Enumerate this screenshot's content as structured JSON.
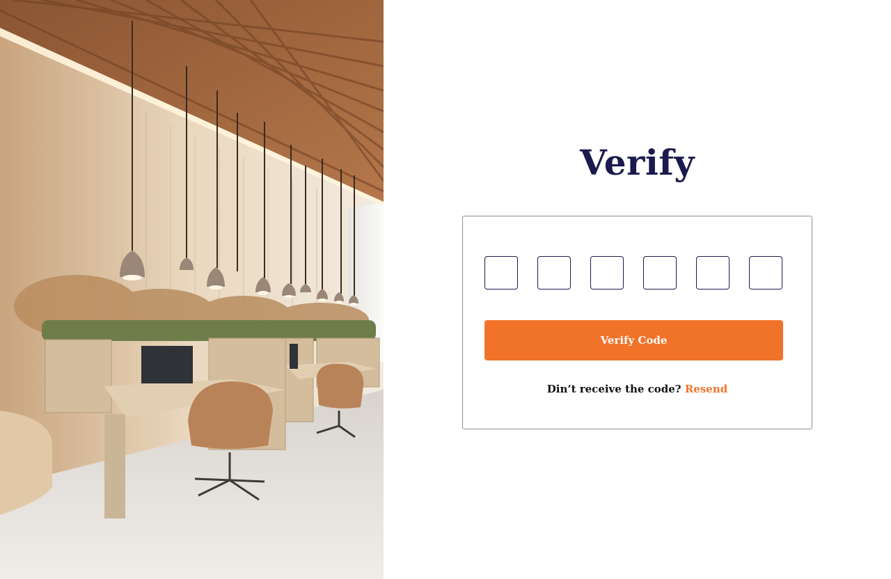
{
  "page": {
    "title": "Verify"
  },
  "otp": {
    "digits": [
      "",
      "",
      "",
      "",
      "",
      ""
    ]
  },
  "actions": {
    "verify_label": "Verify Code",
    "resend_prompt": "Din’t receive the code?",
    "resend_label": "Resend"
  },
  "colors": {
    "accent": "#f1732a",
    "title": "#1b1a4e",
    "card_border": "#8f8f8f"
  },
  "image": {
    "subject": "modern office interior with wooden slatted ceiling, pendant lamps, desks and chairs"
  }
}
